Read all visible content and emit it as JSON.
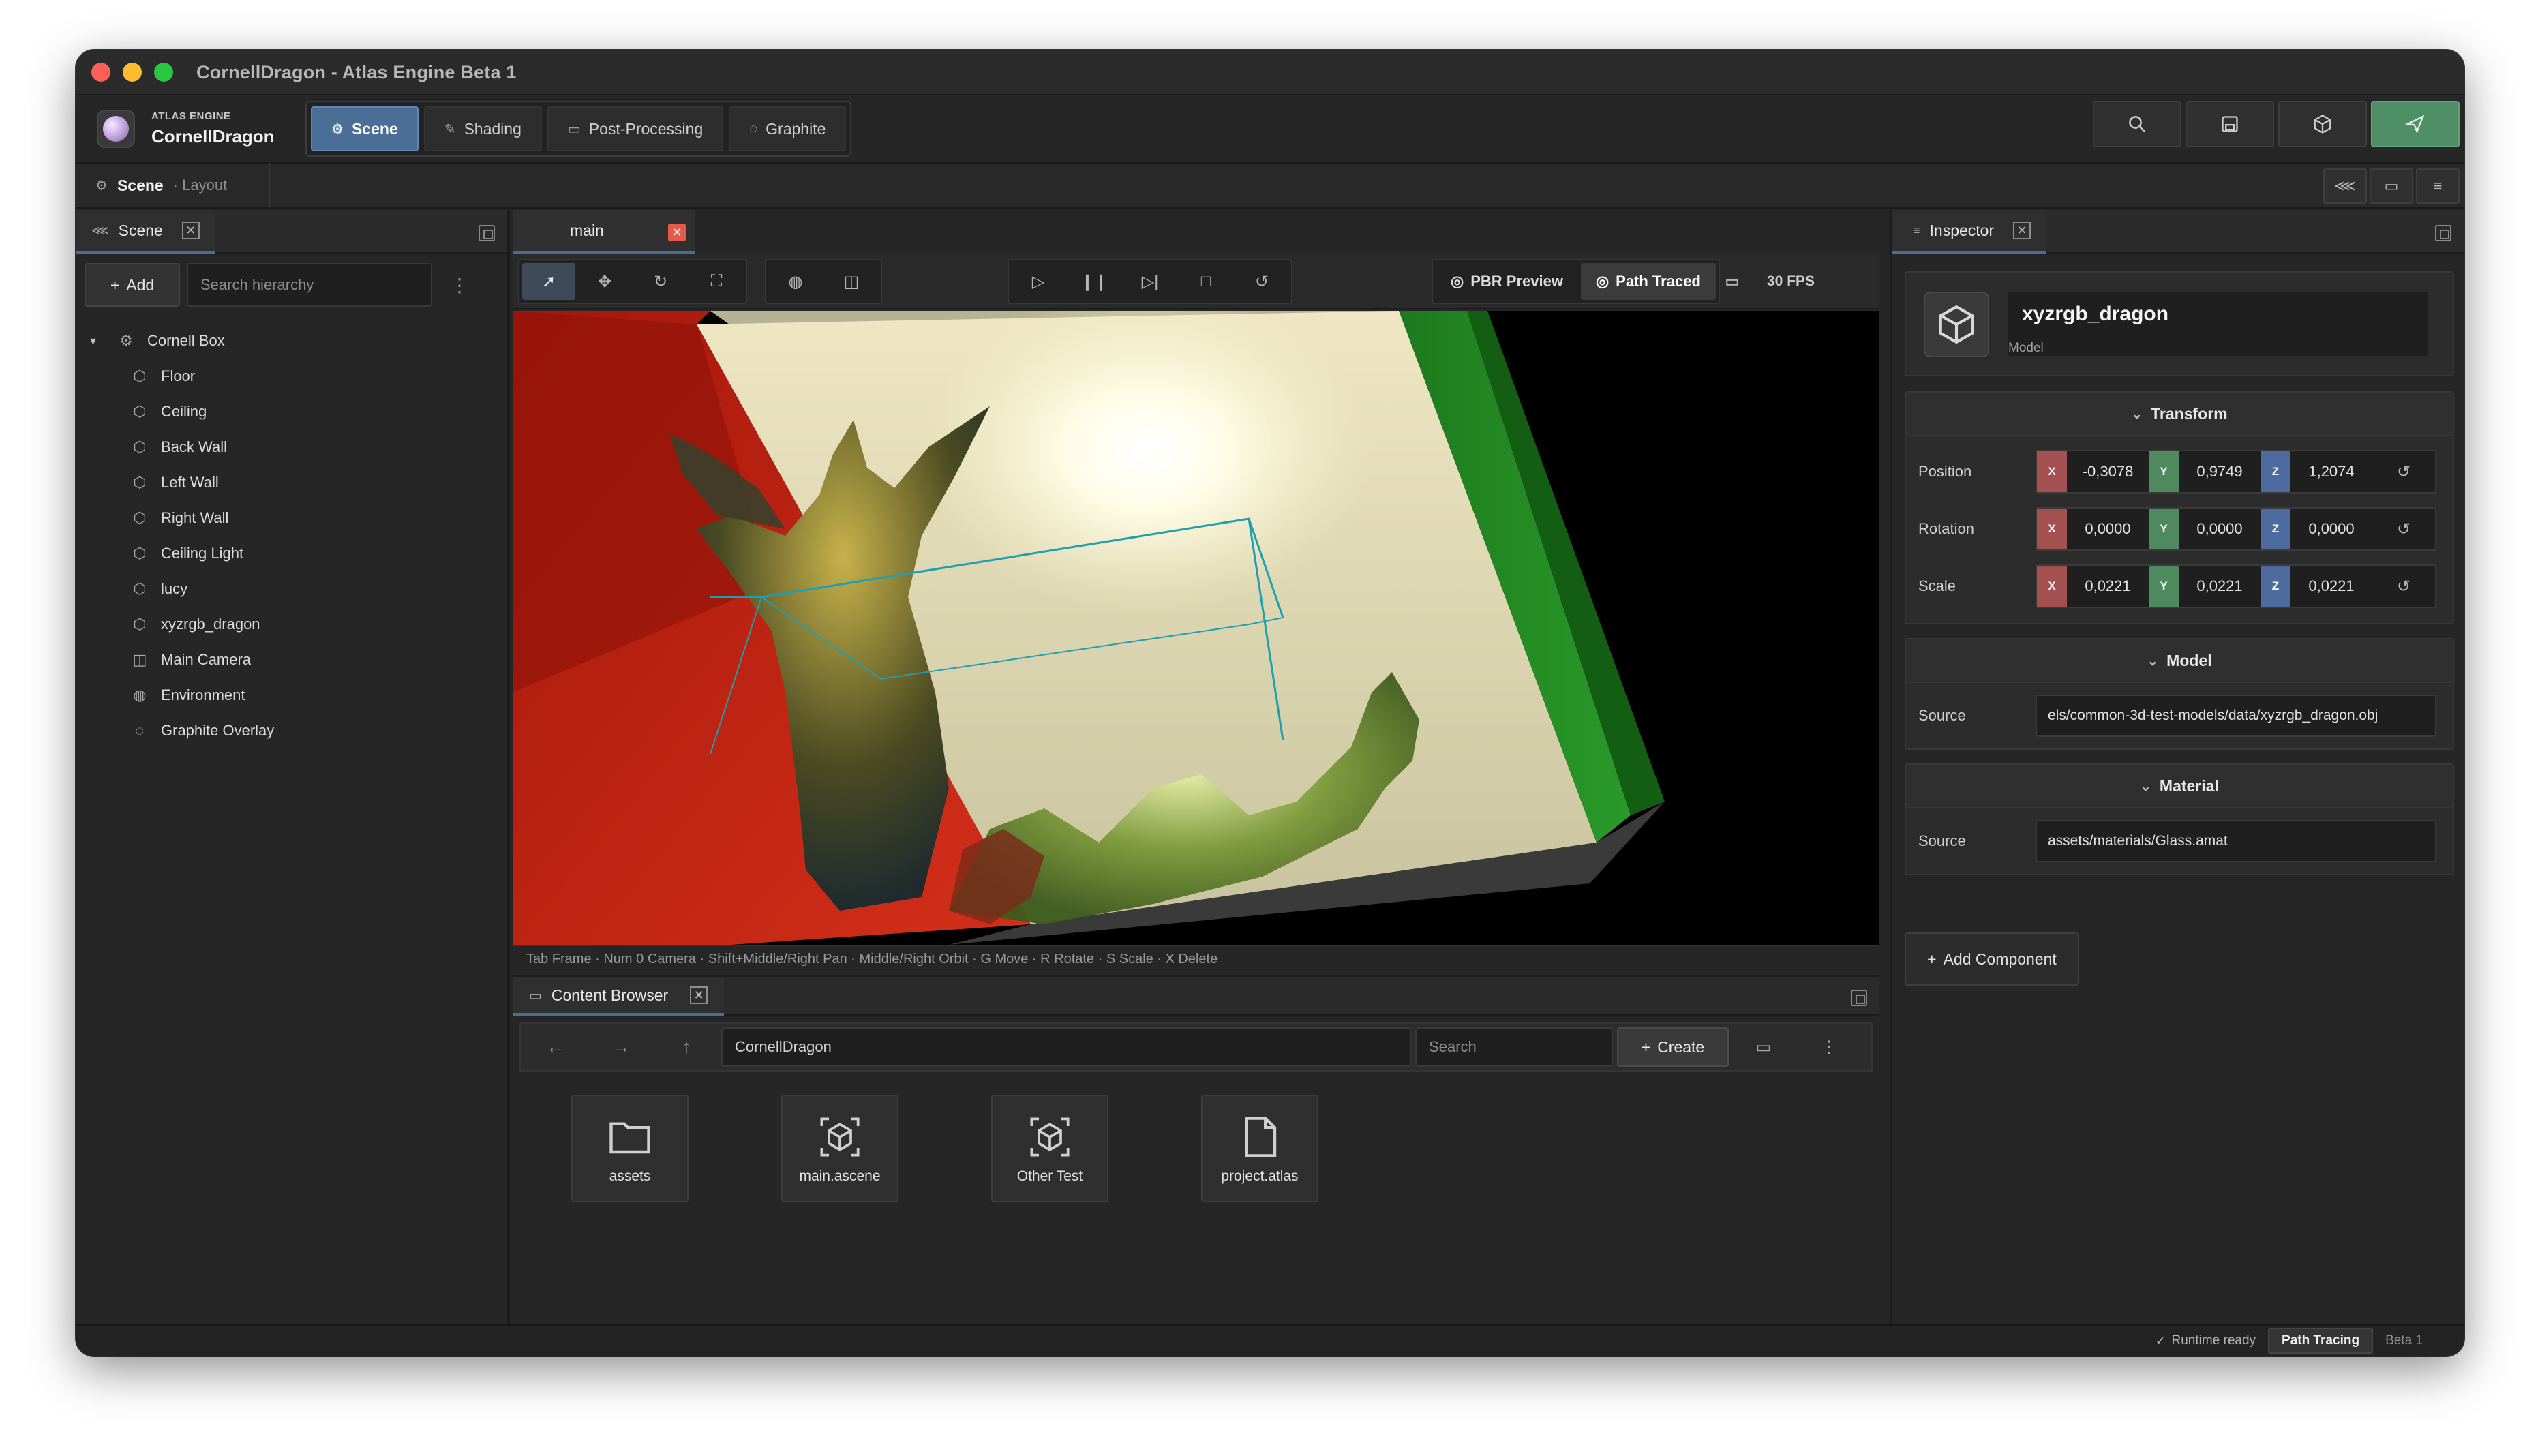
{
  "window": {
    "title": "CornellDragon - Atlas Engine Beta 1",
    "traffic_colors": [
      "#ff5f57",
      "#febc2e",
      "#28c840"
    ]
  },
  "app": {
    "kicker": "ATLAS ENGINE",
    "project": "CornellDragon"
  },
  "modes": [
    {
      "label": "Scene",
      "icon": "scene-icon",
      "active": true
    },
    {
      "label": "Shading",
      "icon": "brush-icon",
      "active": false
    },
    {
      "label": "Post-Processing",
      "icon": "layers-icon",
      "active": false
    },
    {
      "label": "Graphite",
      "icon": "chat-icon",
      "active": false
    }
  ],
  "toolbar_actions": [
    "search-icon",
    "save-icon",
    "cube-icon",
    "launch-icon"
  ],
  "subbar": {
    "title": "Scene",
    "subtitle": "· Layout"
  },
  "hierarchy": {
    "tab": "Scene",
    "add_label": "Add",
    "search_placeholder": "Search hierarchy",
    "root": "Cornell Box",
    "items": [
      {
        "label": "Floor",
        "icon": "cube-icon"
      },
      {
        "label": "Ceiling",
        "icon": "cube-icon"
      },
      {
        "label": "Back Wall",
        "icon": "cube-icon"
      },
      {
        "label": "Left Wall",
        "icon": "cube-icon"
      },
      {
        "label": "Right Wall",
        "icon": "cube-icon"
      },
      {
        "label": "Ceiling Light",
        "icon": "cube-icon"
      },
      {
        "label": "lucy",
        "icon": "cube-icon"
      },
      {
        "label": "xyzrgb_dragon",
        "icon": "cube-icon"
      },
      {
        "label": "Main Camera",
        "icon": "camera-icon"
      },
      {
        "label": "Environment",
        "icon": "globe-icon"
      },
      {
        "label": "Graphite Overlay",
        "icon": "chat-icon"
      }
    ]
  },
  "viewport": {
    "tab": "main",
    "render_modes": [
      {
        "label": "PBR Preview",
        "active": false
      },
      {
        "label": "Path Traced",
        "active": true
      }
    ],
    "fps": "30 FPS",
    "hints": "Tab Frame · Num 0 Camera · Shift+Middle/Right Pan · Middle/Right Orbit · G Move · R Rotate · S Scale · X Delete",
    "colors": {
      "left_wall": "#c0210f",
      "right_wall": "#1f8a1f",
      "back_wall": "#d9d3b4"
    }
  },
  "content_browser": {
    "tab": "Content Browser",
    "path": "CornellDragon",
    "search_placeholder": "Search",
    "create_label": "Create",
    "assets": [
      {
        "label": "assets",
        "icon": "folder-icon"
      },
      {
        "label": "main.ascene",
        "icon": "scene-file-icon"
      },
      {
        "label": "Other Test",
        "icon": "scene-file-icon"
      },
      {
        "label": "project.atlas",
        "icon": "file-icon"
      }
    ]
  },
  "inspector": {
    "tab": "Inspector",
    "name": "xyzrgb_dragon",
    "type": "Model",
    "transform": {
      "title": "Transform",
      "rows": [
        {
          "label": "Position",
          "x": "-0,3078",
          "y": "0,9749",
          "z": "1,2074"
        },
        {
          "label": "Rotation",
          "x": "0,0000",
          "y": "0,0000",
          "z": "0,0000"
        },
        {
          "label": "Scale",
          "x": "0,0221",
          "y": "0,0221",
          "z": "0,0221"
        }
      ]
    },
    "model": {
      "title": "Model",
      "source_label": "Source",
      "source": "els/common-3d-test-models/data/xyzrgb_dragon.obj"
    },
    "material": {
      "title": "Material",
      "source_label": "Source",
      "source": "assets/materials/Glass.amat"
    },
    "add_component": "Add Component"
  },
  "status": {
    "runtime": "Runtime ready",
    "mode": "Path Tracing",
    "version": "Beta 1"
  }
}
